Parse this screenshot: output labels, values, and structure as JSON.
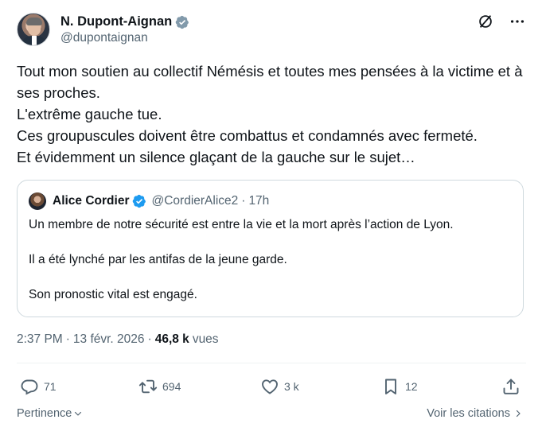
{
  "author": {
    "display_name": "N. Dupont-Aignan",
    "handle": "@dupontaignan",
    "badge": "grey-verified-badge-icon"
  },
  "post": {
    "lines": [
      "Tout mon soutien au collectif Némésis et toutes mes pensées à la victime et à ses proches.",
      "L'extrême gauche tue.",
      "Ces groupuscules doivent être combattus et condamnés avec fermeté.",
      "Et évidemment un silence glaçant de la gauche sur le sujet…"
    ]
  },
  "quoted": {
    "display_name": "Alice Cordier",
    "handle": "@CordierAlice2",
    "separator": "·",
    "time": "17h",
    "paragraphs": [
      "Un membre de notre sécurité est entre la vie et la mort après l’action de Lyon.",
      "Il a été lynché par les antifas de la jeune garde.",
      "Son pronostic vital est engagé."
    ]
  },
  "meta": {
    "time": "2:37 PM",
    "separator1": "·",
    "date": "13 févr. 2026",
    "separator2": "·",
    "views_count": "46,8 k",
    "views_label": "vues"
  },
  "actions": {
    "replies": "71",
    "reposts": "694",
    "likes": "3 k",
    "bookmarks": "12"
  },
  "footer": {
    "sort_label": "Pertinence",
    "quotes_label": "Voir les citations"
  },
  "colors": {
    "text": "#0f1419",
    "secondary": "#536471",
    "verified_blue": "#1d9bf0",
    "verified_grey": "#829aab",
    "border": "#cfd9de"
  }
}
